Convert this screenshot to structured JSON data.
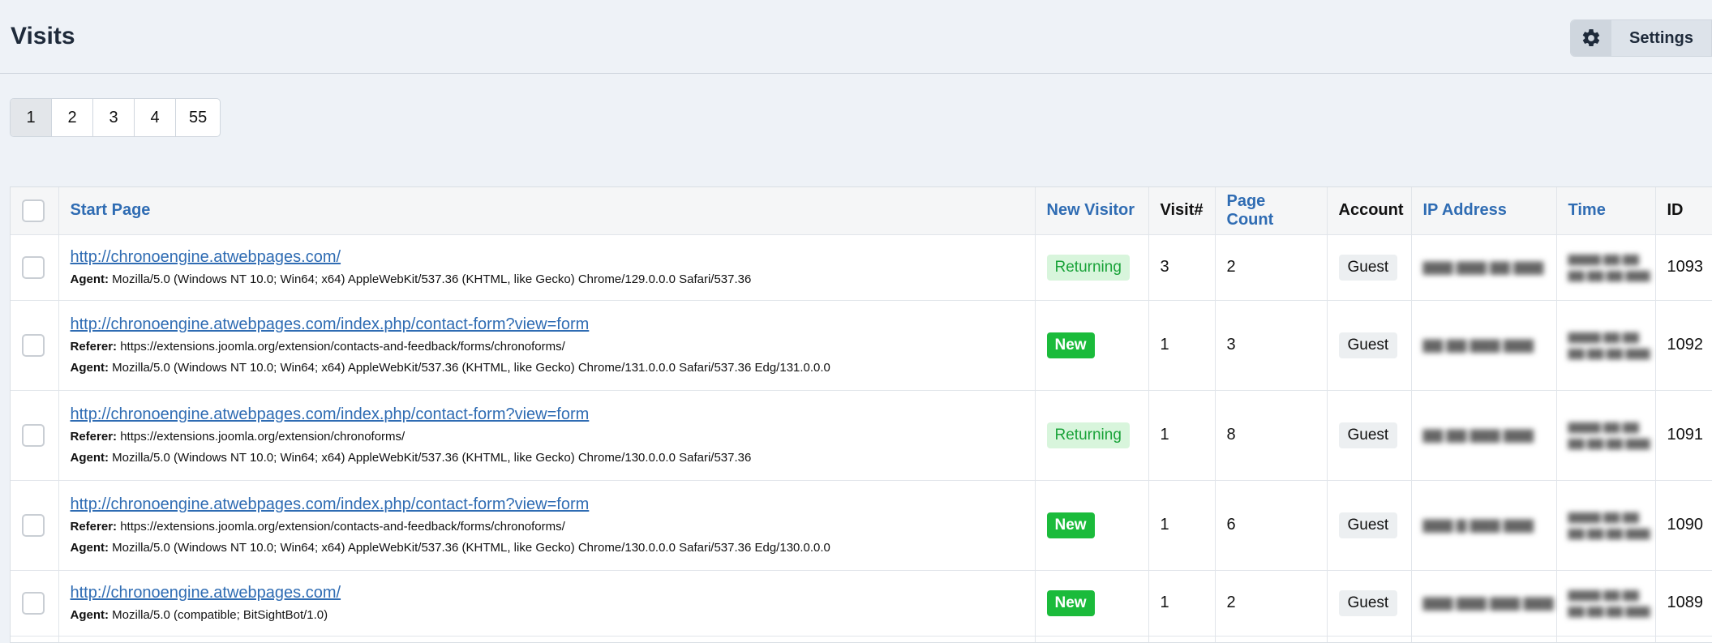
{
  "header": {
    "title": "Visits",
    "settings_label": "Settings"
  },
  "pagination": [
    "1",
    "2",
    "3",
    "4",
    "55"
  ],
  "table": {
    "columns": {
      "start_page": "Start Page",
      "new_visitor": "New Visitor",
      "visit_num": "Visit#",
      "page_count": "Page Count",
      "account": "Account",
      "ip_address": "IP Address",
      "time": "Time",
      "id": "ID"
    },
    "labels": {
      "referer": "Referer:",
      "agent": "Agent:"
    },
    "rows": [
      {
        "start_page": "http://chronoengine.atwebpages.com/",
        "agent": "Mozilla/5.0 (Windows NT 10.0; Win64; x64) AppleWebKit/537.36 (KHTML, like Gecko) Chrome/129.0.0.0 Safari/537.36",
        "status": "Returning",
        "visit_num": "3",
        "page_count": "2",
        "account": "Guest",
        "id": "1093"
      },
      {
        "start_page": "http://chronoengine.atwebpages.com/index.php/contact-form?view=form",
        "referer": "https://extensions.joomla.org/extension/contacts-and-feedback/forms/chronoforms/",
        "agent": "Mozilla/5.0 (Windows NT 10.0; Win64; x64) AppleWebKit/537.36 (KHTML, like Gecko) Chrome/131.0.0.0 Safari/537.36 Edg/131.0.0.0",
        "status": "New",
        "visit_num": "1",
        "page_count": "3",
        "account": "Guest",
        "id": "1092"
      },
      {
        "start_page": "http://chronoengine.atwebpages.com/index.php/contact-form?view=form",
        "referer": "https://extensions.joomla.org/extension/chronoforms/",
        "agent": "Mozilla/5.0 (Windows NT 10.0; Win64; x64) AppleWebKit/537.36 (KHTML, like Gecko) Chrome/130.0.0.0 Safari/537.36",
        "status": "Returning",
        "visit_num": "1",
        "page_count": "8",
        "account": "Guest",
        "id": "1091"
      },
      {
        "start_page": "http://chronoengine.atwebpages.com/index.php/contact-form?view=form",
        "referer": "https://extensions.joomla.org/extension/contacts-and-feedback/forms/chronoforms/",
        "agent": "Mozilla/5.0 (Windows NT 10.0; Win64; x64) AppleWebKit/537.36 (KHTML, like Gecko) Chrome/130.0.0.0 Safari/537.36 Edg/130.0.0.0",
        "status": "New",
        "visit_num": "1",
        "page_count": "6",
        "account": "Guest",
        "id": "1090"
      },
      {
        "start_page": "http://chronoengine.atwebpages.com/",
        "agent": "Mozilla/5.0 (compatible; BitSightBot/1.0)",
        "status": "New",
        "visit_num": "1",
        "page_count": "2",
        "account": "Guest",
        "id": "1089"
      }
    ]
  },
  "colors": {
    "link": "#2f6cb3",
    "new_badge": "#1bbb3b",
    "returning_badge_bg": "#d8f5dc",
    "returning_badge_text": "#1aa33a",
    "page_bg": "#eef2f7"
  }
}
